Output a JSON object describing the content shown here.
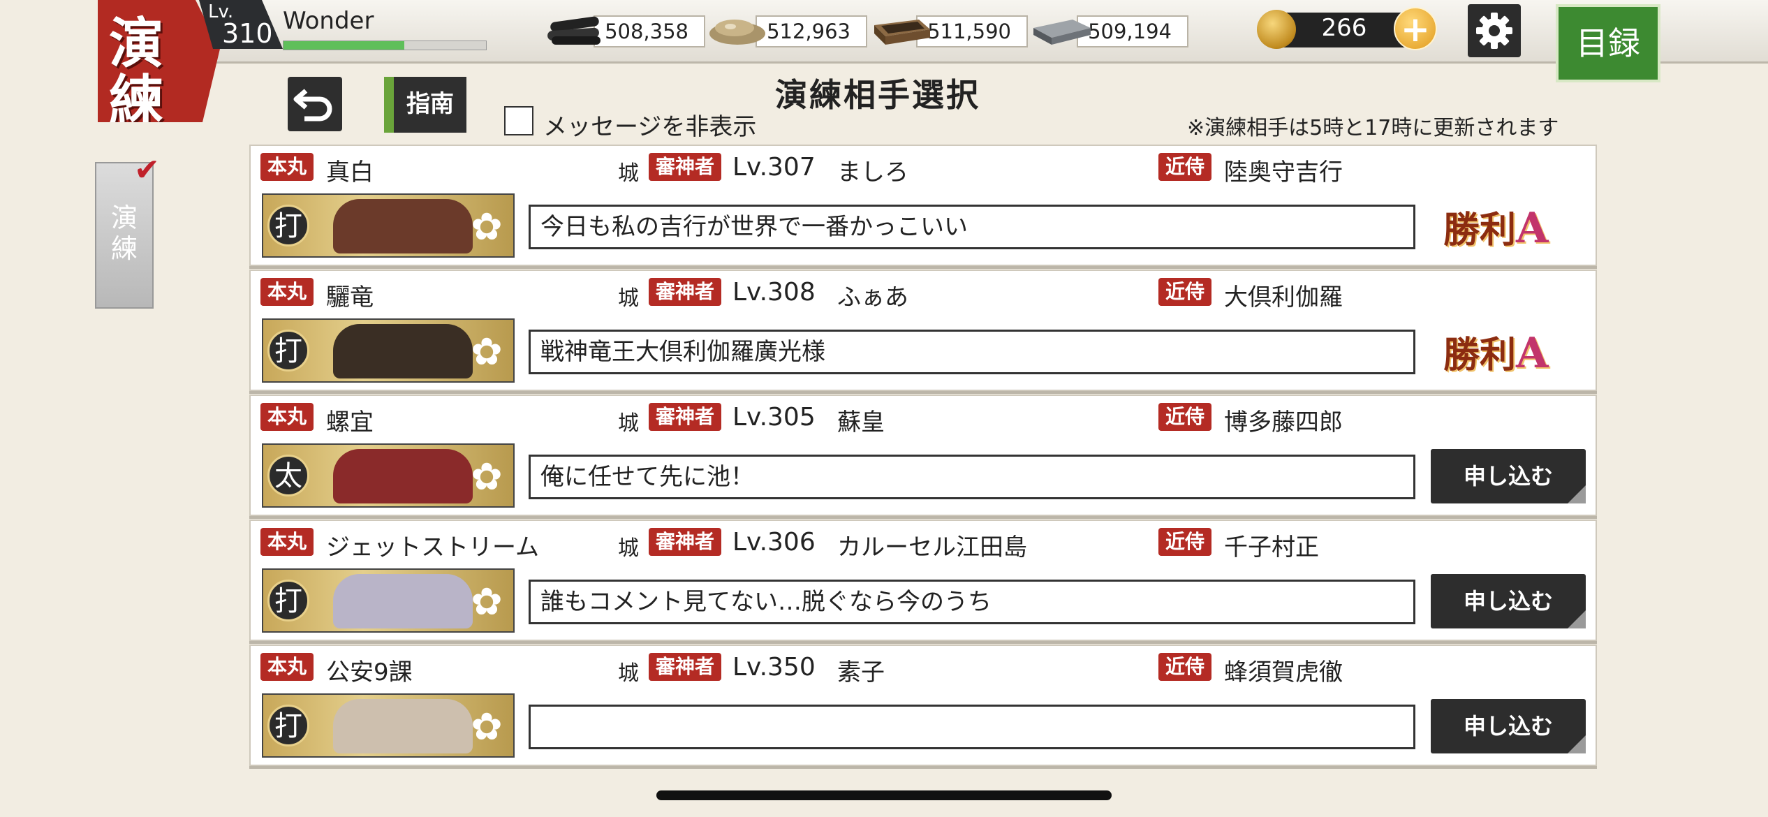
{
  "mode_badge": {
    "top": "演",
    "bottom": "練"
  },
  "player": {
    "level_caption": "Lv.",
    "level": "310",
    "name": "Wonder",
    "exp_fraction": 0.6
  },
  "resources": [
    {
      "icon": "charcoal-icon",
      "value": "508,358"
    },
    {
      "icon": "steel-ore-icon",
      "value": "512,963"
    },
    {
      "icon": "coolant-icon",
      "value": "511,590"
    },
    {
      "icon": "whetstone-icon",
      "value": "509,194"
    }
  ],
  "coins": {
    "value": "266",
    "plus": "+"
  },
  "catalog_label": "目録",
  "guide_label": "指南",
  "hide_messages_label": "メッセージを非表示",
  "page_title": "演練相手選択",
  "notice": "※演練相手は5時と17時に更新されます",
  "side_tab": {
    "label_1": "演",
    "label_2": "練"
  },
  "row_labels": {
    "honmaru": "本丸",
    "castle": "城",
    "saniwa": "審神者",
    "attendant": "近侍"
  },
  "opponents": [
    {
      "honmaru": "真白",
      "level": "Lv.307",
      "saniwa_name": "ましろ",
      "attendant": "陸奥守吉行",
      "type": "打",
      "message": "今日も私の吉行が世界で一番かっこいい",
      "status": "result",
      "result_text": "勝利",
      "result_grade": "A",
      "face_color": "#6b3a2a"
    },
    {
      "honmaru": "驪竜",
      "level": "Lv.308",
      "saniwa_name": "ふぁあ",
      "attendant": "大倶利伽羅",
      "type": "打",
      "message": "戦神竜王大倶利伽羅廣光様",
      "status": "result",
      "result_text": "勝利",
      "result_grade": "A",
      "face_color": "#3a2e24"
    },
    {
      "honmaru": "螺宜",
      "level": "Lv.305",
      "saniwa_name": "蘇皇",
      "attendant": "博多藤四郎",
      "type": "太",
      "message": "俺に任せて先に池！",
      "status": "apply",
      "apply_label": "申し込む",
      "face_color": "#8a2a2a"
    },
    {
      "honmaru": "ジェットストリーム",
      "level": "Lv.306",
      "saniwa_name": "カルーセル江田島",
      "attendant": "千子村正",
      "type": "打",
      "message": "誰もコメント見てない…脱ぐなら今のうち",
      "status": "apply",
      "apply_label": "申し込む",
      "face_color": "#b9b4c8"
    },
    {
      "honmaru": "公安9課",
      "level": "Lv.350",
      "saniwa_name": "素子",
      "attendant": "蜂須賀虎徹",
      "type": "打",
      "message": "",
      "status": "apply",
      "apply_label": "申し込む",
      "face_color": "#cdbfae"
    }
  ]
}
